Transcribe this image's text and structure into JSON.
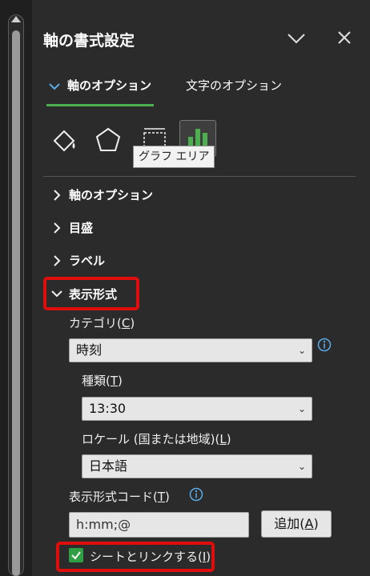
{
  "pane": {
    "title": "軸の書式設定"
  },
  "tabs": {
    "axis_options": "軸のオプション",
    "text_options": "文字のオプション"
  },
  "icon_tooltip": "グラフ エリア",
  "sections": {
    "axis_options": "軸のオプション",
    "ticks": "目盛",
    "labels": "ラベル",
    "number_format": "表示形式"
  },
  "number_format": {
    "category_label": "カテゴリ(",
    "category_key": "C",
    "category_end": ")",
    "category_value": "時刻",
    "type_label": "種類(",
    "type_key": "T",
    "type_end": ")",
    "type_value": "13:30",
    "locale_label": "ロケール (国または地域)(",
    "locale_key": "L",
    "locale_end": ")",
    "locale_value": "日本語",
    "code_label": "表示形式コード(",
    "code_key": "T",
    "code_end": ")",
    "code_value": "h:mm;@",
    "add_label": "追加(",
    "add_key": "A",
    "add_end": ")",
    "link_label": "シートとリンクする(",
    "link_key": "I",
    "link_end": ")",
    "link_checked": true
  },
  "colors": {
    "accent_green": "#4caf50",
    "highlight_red": "#e00d0d",
    "info_blue": "#5aa9e6"
  }
}
